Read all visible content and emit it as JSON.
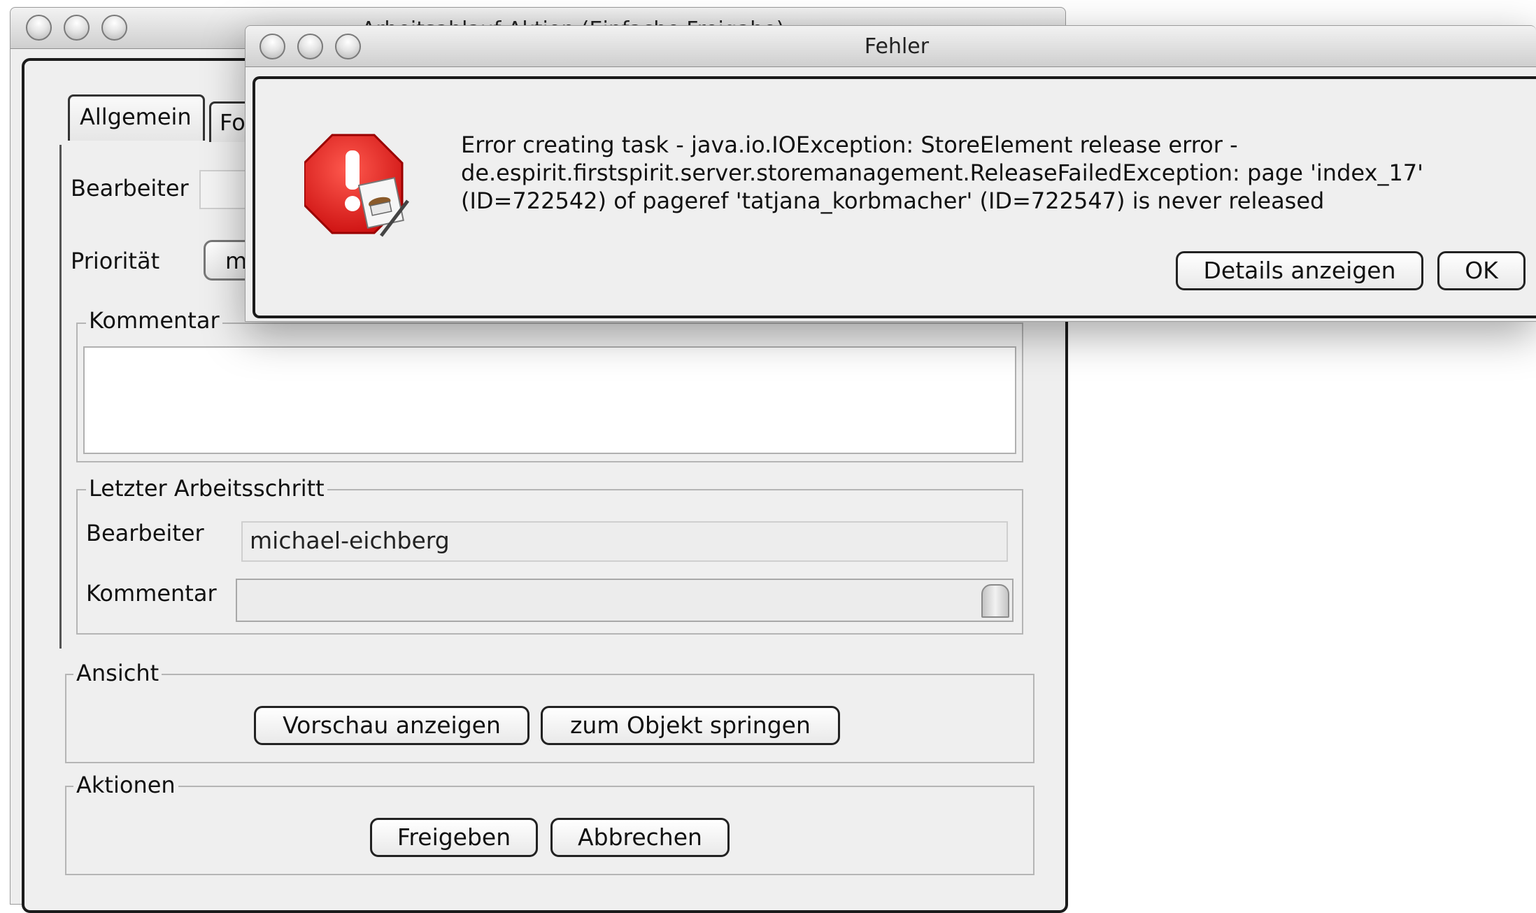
{
  "back_window": {
    "title": "Arbeitsablauf Aktion (Einfache Freigabe)",
    "tabs": [
      "Allgemein",
      "Fo"
    ],
    "bearbeiter_label": "Bearbeiter",
    "prioritaet_label": "Priorität",
    "prioritaet_value": "mi",
    "kommentar_legend": "Kommentar",
    "letzter_schritt": {
      "legend": "Letzter Arbeitsschritt",
      "bearbeiter_label": "Bearbeiter",
      "bearbeiter_value": "michael-eichberg",
      "kommentar_label": "Kommentar"
    },
    "ansicht": {
      "legend": "Ansicht",
      "preview_button": "Vorschau anzeigen",
      "jump_button": "zum Objekt springen"
    },
    "aktionen": {
      "legend": "Aktionen",
      "release_button": "Freigeben",
      "cancel_button": "Abbrechen"
    }
  },
  "error_dialog": {
    "title": "Fehler",
    "icon": "error-stop-icon",
    "message_lines": [
      "Error creating task - java.io.IOException: StoreElement release error -",
      "de.espirit.firstspirit.server.storemanagement.ReleaseFailedException: page 'index_17'",
      "(ID=722542) of pageref 'tatjana_korbmacher' (ID=722547) is never released"
    ],
    "details_button": "Details anzeigen",
    "ok_button": "OK"
  },
  "colors": {
    "window_bg": "#eeeeee",
    "error_red": "#e02020"
  }
}
